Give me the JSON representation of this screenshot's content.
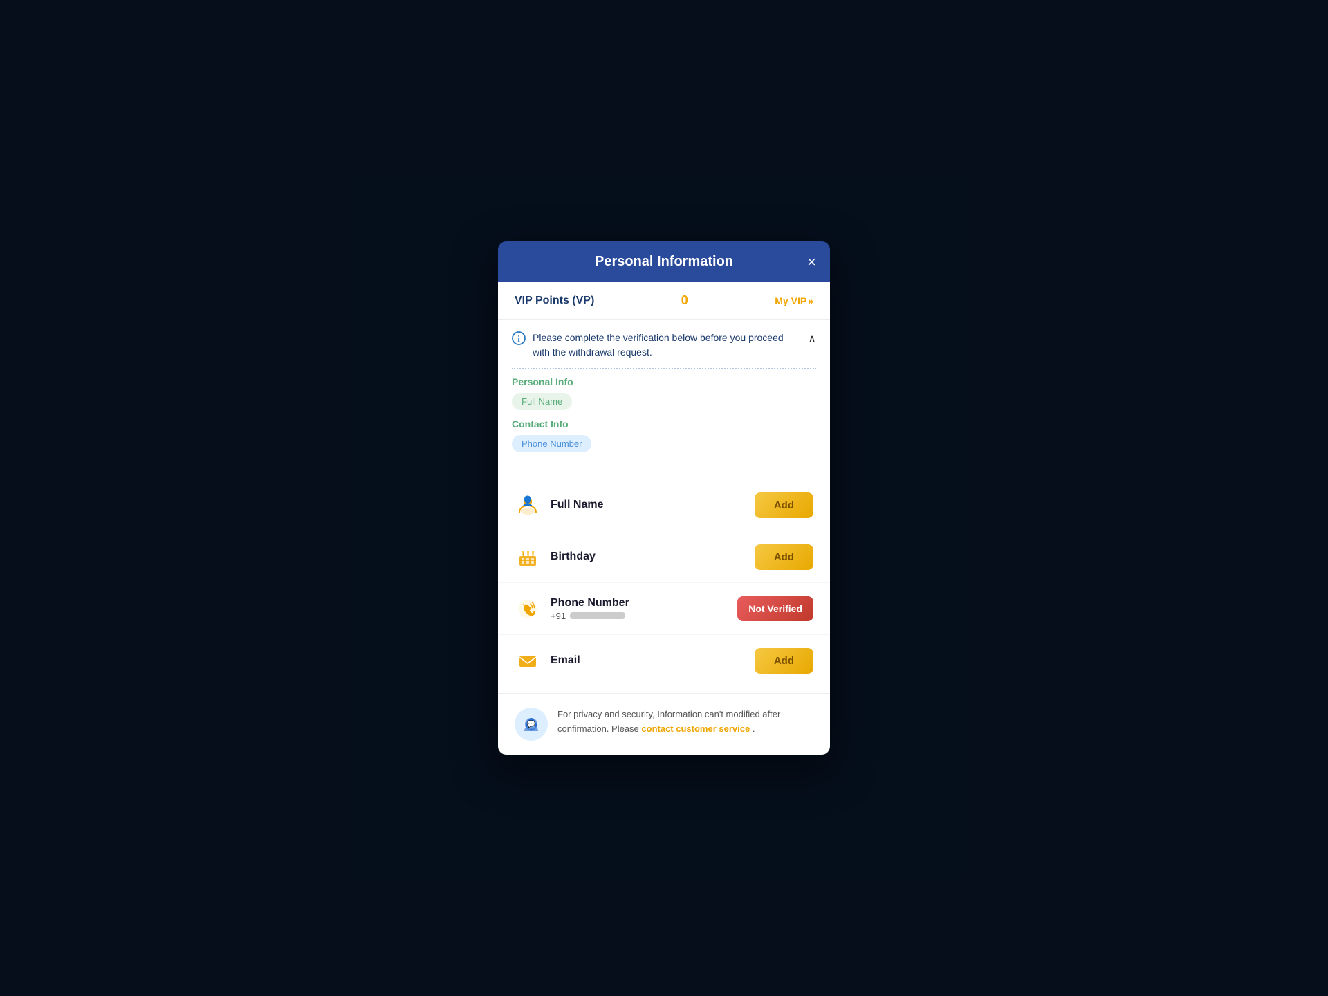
{
  "modal": {
    "title": "Personal Information",
    "close_label": "×"
  },
  "vip": {
    "label": "VIP Points (VP)",
    "points": "0",
    "my_vip_label": "My VIP",
    "arrow": "»"
  },
  "verification": {
    "notice_text": "Please complete the verification below before you proceed with the withdrawal request.",
    "personal_info_label": "Personal Info",
    "full_name_tag": "Full Name",
    "contact_info_label": "Contact Info",
    "phone_number_tag": "Phone Number",
    "chevron": "∧"
  },
  "fields": [
    {
      "id": "full-name",
      "name": "Full Name",
      "icon_type": "user",
      "button_type": "add",
      "button_label": "Add"
    },
    {
      "id": "birthday",
      "name": "Birthday",
      "icon_type": "birthday",
      "button_type": "add",
      "button_label": "Add"
    },
    {
      "id": "phone-number",
      "name": "Phone Number",
      "sub": "+91",
      "icon_type": "phone",
      "button_type": "not-verified",
      "button_label": "Not Verified"
    },
    {
      "id": "email",
      "name": "Email",
      "icon_type": "email",
      "button_type": "add",
      "button_label": "Add"
    }
  ],
  "footer": {
    "privacy_text_before": "For privacy and security, Information can't modified after confirmation. Please ",
    "link_text": "contact customer service",
    "period": " ."
  },
  "colors": {
    "accent_yellow": "#f0a500",
    "accent_green": "#5aad7a",
    "accent_blue": "#2a4a9c",
    "red": "#e85c5c"
  }
}
